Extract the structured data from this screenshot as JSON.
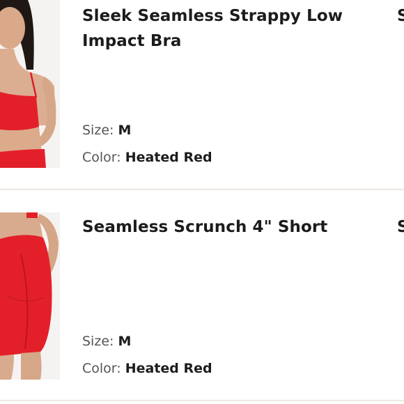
{
  "cart": {
    "items": [
      {
        "title": "Sleek Seamless Strappy Low Impact Bra",
        "size_label": "Size:",
        "size_value": "M",
        "color_label": "Color:",
        "color_value": "Heated Red",
        "price_peek": "S",
        "product_color": "#e3202a"
      },
      {
        "title": "Seamless Scrunch 4\" Short",
        "size_label": "Size:",
        "size_value": "M",
        "color_label": "Color:",
        "color_value": "Heated Red",
        "price_peek": "S",
        "product_color": "#e3202a"
      }
    ]
  }
}
